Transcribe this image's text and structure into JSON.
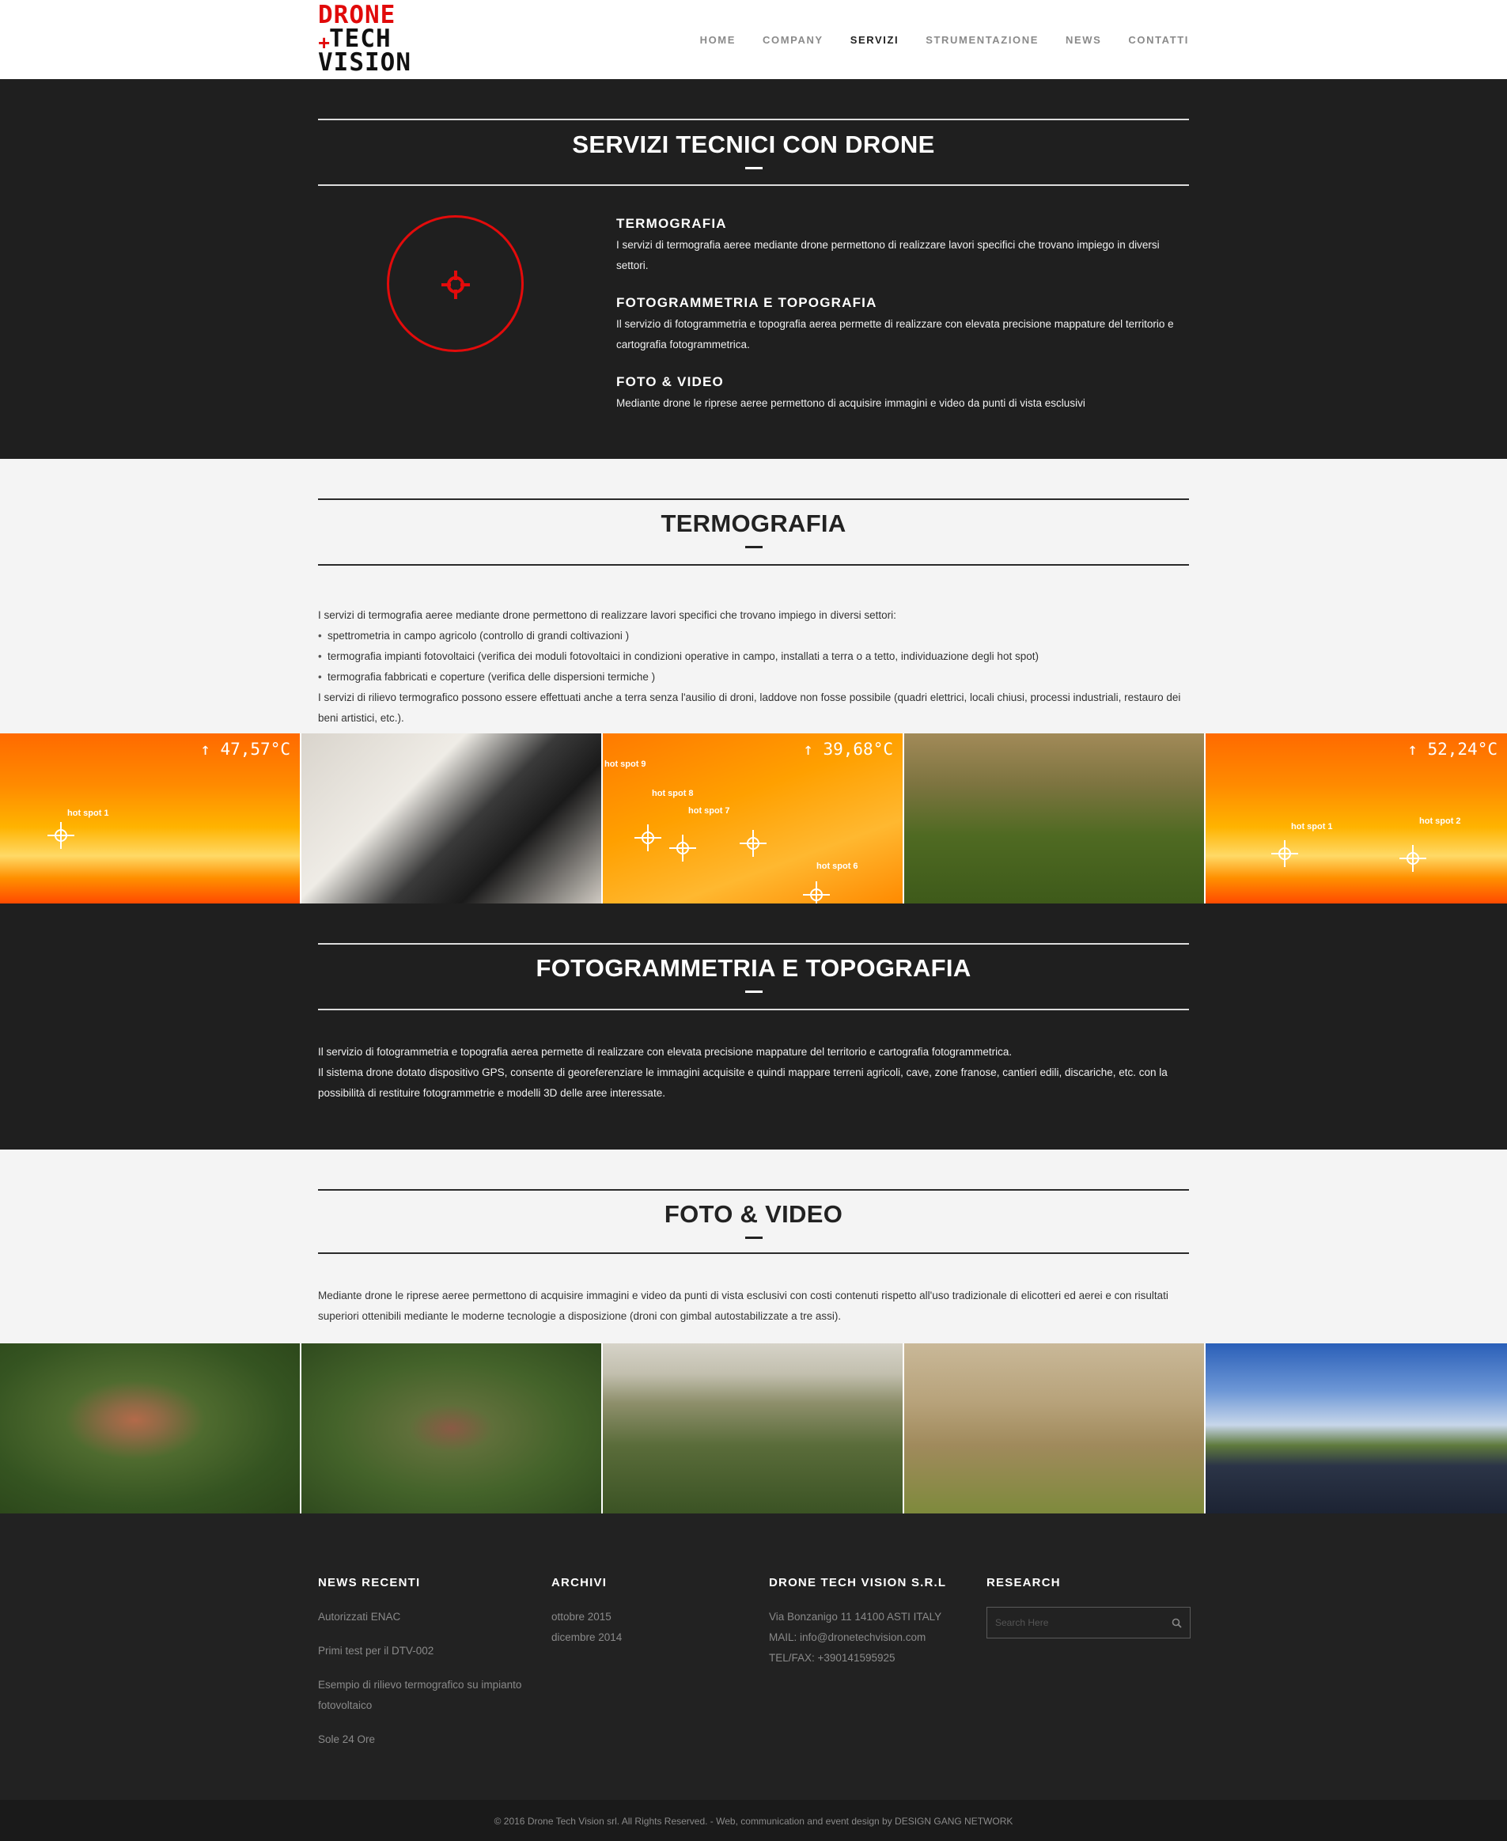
{
  "nav": {
    "logo_lines": [
      "DRONE",
      "TECH",
      "VISION"
    ],
    "items": [
      {
        "label": "HOME",
        "active": false
      },
      {
        "label": "COMPANY",
        "active": false
      },
      {
        "label": "SERVIZI",
        "active": true
      },
      {
        "label": "STRUMENTAZIONE",
        "active": false
      },
      {
        "label": "NEWS",
        "active": false
      },
      {
        "label": "CONTATTI",
        "active": false
      }
    ]
  },
  "intro": {
    "title": "SERVIZI TECNICI CON DRONE",
    "icon": "crosshair-icon",
    "services": [
      {
        "title": "TERMOGRAFIA",
        "text": "I servizi di termografia aeree mediante drone permettono di realizzare lavori specifici che trovano impiego in diversi settori."
      },
      {
        "title": "FOTOGRAMMETRIA E TOPOGRAFIA",
        "text": "Il servizio di fotogrammetria e topografia aerea permette di realizzare con elevata precisione mappature del territorio e cartografia fotogrammetrica."
      },
      {
        "title": "FOTO & VIDEO",
        "text": "Mediante drone le riprese aeree permettono di acquisire immagini e video da punti di vista esclusivi"
      }
    ]
  },
  "termografia": {
    "title": "TERMOGRAFIA",
    "intro": "I servizi di termografia aeree mediante drone permettono di realizzare lavori specifici che trovano impiego in diversi settori:",
    "bullets": [
      "spettrometria in campo agricolo (controllo di grandi coltivazioni )",
      "termografia impianti fotovoltaici (verifica dei moduli fotovoltaici in condizioni operative in campo, installati a terra o a tetto, individuazione degli hot spot)",
      "termografia fabbricati e coperture (verifica delle dispersioni termiche )"
    ],
    "outro": "I servizi di rilievo termografico possono essere effettuati anche a terra senza l'ausilio di droni, laddove non fosse possibile (quadri elettrici, locali chiusi, processi industriali, restauro dei beni artistici, etc.).",
    "gallery": {
      "temp1": "↑ 47,57°C",
      "temp2": "↑ 39,68°C",
      "temp3": "↑ 52,24°C",
      "hs1": "hot spot 1",
      "hs9": "hot spot 9",
      "hs8": "hot spot 8",
      "hs7": "hot spot 7",
      "hs6": "hot spot 6",
      "hs3a": "hot spot 1",
      "hs3b": "hot spot 2"
    }
  },
  "fotogrammetria": {
    "title": "FOTOGRAMMETRIA E TOPOGRAFIA",
    "line1": "Il servizio di fotogrammetria e topografia aerea permette di realizzare con elevata precisione mappature del territorio e cartografia fotogrammetrica.",
    "line2": "Il sistema drone dotato dispositivo GPS, consente di georeferenziare le immagini acquisite e quindi mappare terreni agricoli, cave, zone franose, cantieri edili, discariche, etc. con la possibilità di restituire fotogrammetrie e modelli 3D delle aree interessate."
  },
  "foto": {
    "title": "FOTO & VIDEO",
    "text": "Mediante drone le riprese aeree permettono di acquisire immagini e video da punti di vista esclusivi con costi contenuti rispetto all'uso tradizionale di elicotteri ed aerei e con risultati superiori ottenibili mediante le moderne tecnologie a disposizione (droni con gimbal autostabilizzate a tre assi)."
  },
  "footer": {
    "news_title": "NEWS RECENTI",
    "news": [
      "Autorizzati ENAC",
      "Primi test per il DTV-002",
      "Esempio di rilievo termografico su impianto fotovoltaico",
      "Sole 24 Ore"
    ],
    "archive_title": "ARCHIVI",
    "archive": [
      "ottobre 2015",
      "dicembre 2014"
    ],
    "company_title": "DRONE TECH VISION S.R.L",
    "company": [
      "Via Bonzanigo 11 14100 ASTI ITALY",
      "MAIL: info@dronetechvision.com",
      "TEL/FAX: +390141595925"
    ],
    "research_title": "RESEARCH",
    "search_placeholder": "Search Here",
    "copyright": "© 2016 Drone Tech Vision srl. All Rights Reserved. - Web, communication and event design by DESIGN GANG NETWORK"
  }
}
